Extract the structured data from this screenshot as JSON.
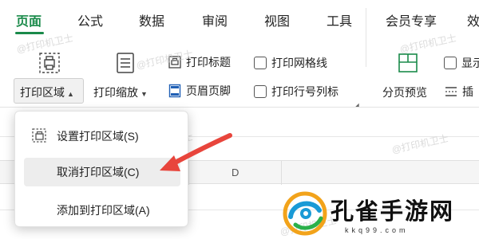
{
  "tabs": [
    {
      "label": "页面",
      "active": true
    },
    {
      "label": "公式"
    },
    {
      "label": "数据"
    },
    {
      "label": "审阅"
    },
    {
      "label": "视图"
    },
    {
      "label": "工具"
    },
    {
      "label": "会员专享"
    },
    {
      "label": "效"
    }
  ],
  "ribbon": {
    "print_area_label": "打印区域",
    "print_scale_label": "打印缩放",
    "print_title_label": "打印标题",
    "header_footer_label": "页眉页脚",
    "print_gridlines_label": "打印网格线",
    "print_row_col_label": "打印行号列标",
    "page_break_preview_label": "分页预览",
    "show_label": "显示",
    "insert_label": "插"
  },
  "dropdown": {
    "items": [
      {
        "label": "设置打印区域(S)"
      },
      {
        "label": "取消打印区域(C)",
        "highlighted": true
      },
      {
        "label": "添加到打印区域(A)"
      }
    ]
  },
  "sheet": {
    "column_label": "D"
  },
  "watermark": "@打印机卫士",
  "logo": {
    "name": "孔雀手游网",
    "domain": "kkq99.com"
  },
  "colors": {
    "accent": "#1a8a4a",
    "arrow": "#e8453c"
  }
}
